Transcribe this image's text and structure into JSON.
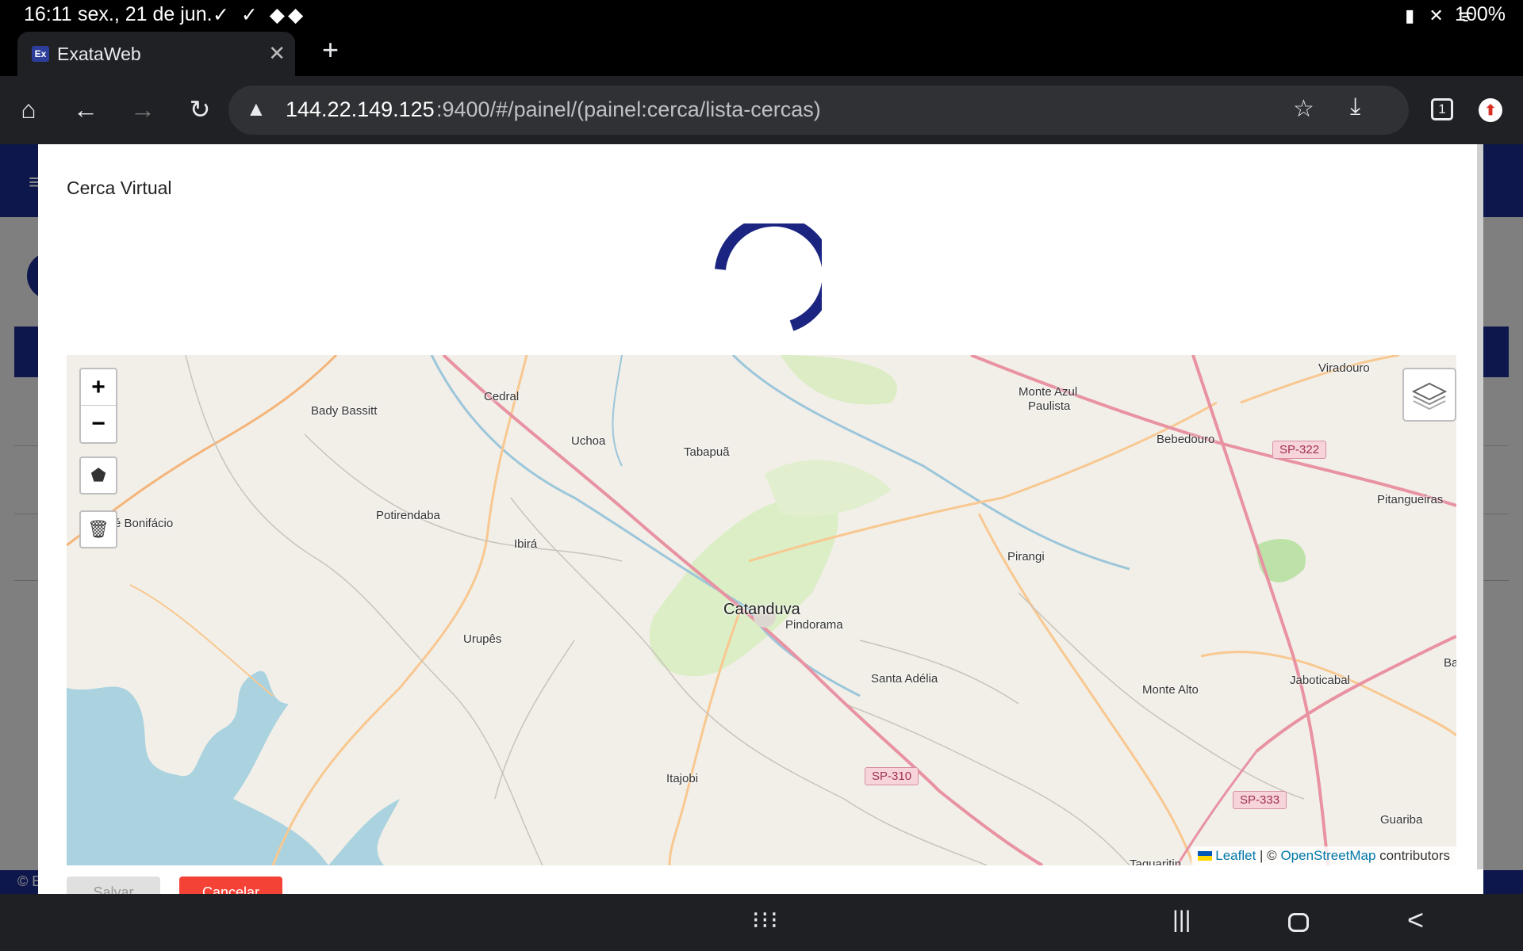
{
  "status_bar": {
    "time": "16:11",
    "date": "sex., 21 de jun.",
    "notification_icons": "✓ ✓ ◆◆",
    "right_icons": "▮ ✕ ᯤ",
    "battery": "100%"
  },
  "browser": {
    "tab_title": "ExataWeb",
    "tab_favicon": "Ex",
    "close_glyph": "✕",
    "new_tab_glyph": "+",
    "url_host": "144.22.149.125",
    "url_path": ":9400/#/painel/(painel:cerca/lista-cercas)",
    "tab_count": "1",
    "home_icon": "⌂",
    "back_icon": "←",
    "forward_icon": "→",
    "reload_icon": "↻",
    "warn_icon": "▲",
    "star_icon": "☆",
    "download_icon": "⤓",
    "profile_icon": "⬆"
  },
  "modal": {
    "title": "Cerca Virtual",
    "save_label": "Salvar",
    "cancel_label": "Cancelar"
  },
  "map": {
    "zoom_in": "+",
    "zoom_out": "−",
    "polygon_icon": "⬟",
    "trash_icon": "🗑",
    "attribution_leaflet": "Leaflet",
    "attribution_sep": " | © ",
    "attribution_osm": "OpenStreetMap",
    "attribution_tail": " contributors",
    "places": {
      "viradouro": "Viradouro",
      "monte_azul": "Monte Azul",
      "paulista": "Paulista",
      "cedral": "Cedral",
      "bady_bassitt": "Bady Bassitt",
      "uchoa": "Uchoa",
      "tabapua": "Tabapuã",
      "bebedouro": "Bebedouro",
      "pitangueiras": "Pitangueiras",
      "bonifacio": "é Bonifácio",
      "potirendaba": "Potirendaba",
      "ibira": "Ibirá",
      "pirangi": "Pirangi",
      "catanduva": "Catanduva",
      "pindorama": "Pindorama",
      "urupes": "Urupês",
      "santa_adelia": "Santa Adélia",
      "monte_alto": "Monte Alto",
      "jaboticabal": "Jaboticabal",
      "itajobi": "Itajobi",
      "guariba": "Guariba",
      "ba": "Ba",
      "taquaritinga": "Taquaritin"
    },
    "roads": {
      "sp322": "SP-322",
      "sp310": "SP-310",
      "sp333": "SP-333"
    }
  },
  "page_background": {
    "footer_text": "© E"
  },
  "nav_bar": {
    "apps_icon": "⁝⁝⁝",
    "recent_icon": "|||",
    "back_icon": "<"
  }
}
